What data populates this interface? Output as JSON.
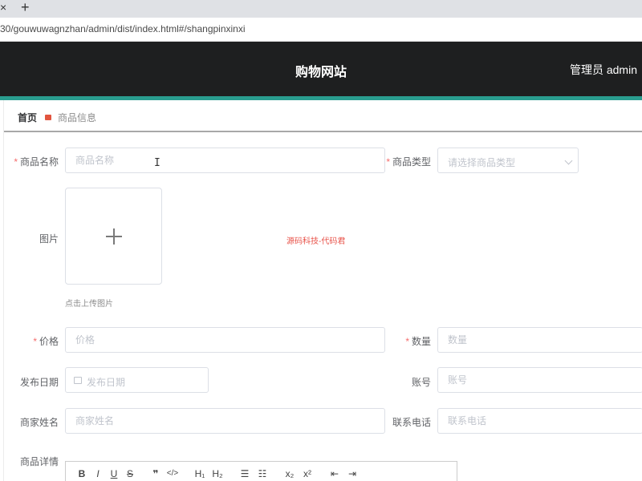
{
  "browser": {
    "close_tab": "×",
    "new_tab": "+",
    "url": "30/gouwuwagnzhan/admin/dist/index.html#/shangpinxinxi"
  },
  "header": {
    "title": "购物网站",
    "user": "管理员 admin"
  },
  "colors": {
    "header_bg": "#1e1f20",
    "accent": "#2a9d8f",
    "required": "#f56c6c"
  },
  "breadcrumb": {
    "home": "首页",
    "current": "商品信息"
  },
  "form": {
    "product_name": {
      "label": "商品名称",
      "placeholder": "商品名称"
    },
    "product_type": {
      "label": "商品类型",
      "placeholder": "请选择商品类型"
    },
    "image": {
      "label": "图片",
      "tip": "点击上传图片",
      "watermark": "源码科技-代码君"
    },
    "price": {
      "label": "价格",
      "placeholder": "价格"
    },
    "quantity": {
      "label": "数量",
      "placeholder": "数量"
    },
    "publish_date": {
      "label": "发布日期",
      "placeholder": "发布日期"
    },
    "account": {
      "label": "账号",
      "placeholder": "账号"
    },
    "merchant_name": {
      "label": "商家姓名",
      "placeholder": "商家姓名"
    },
    "phone": {
      "label": "联系电话",
      "placeholder": "联系电话"
    },
    "details": {
      "label": "商品详情"
    },
    "required_mark": "*"
  },
  "editor_toolbar": [
    "B",
    "I",
    "U",
    "S",
    "❞",
    "</>",
    "H₁",
    "H₂",
    "☰",
    "☷",
    "x₂",
    "x²",
    "⇤",
    "⇥"
  ]
}
